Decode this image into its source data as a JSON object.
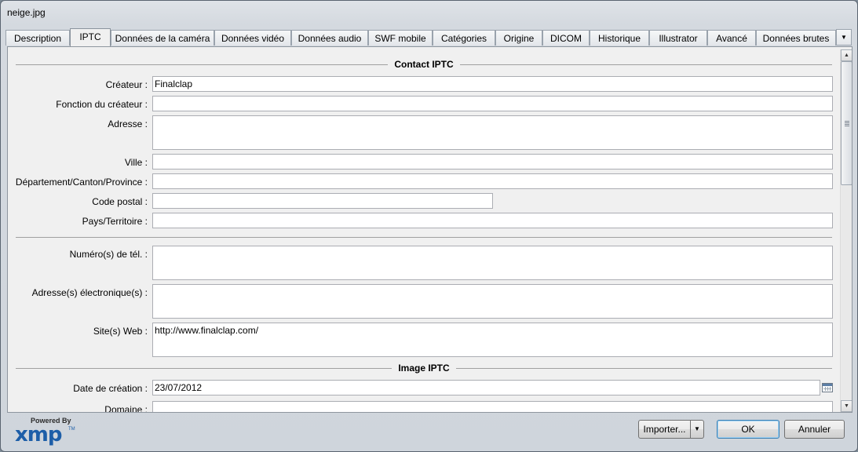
{
  "window": {
    "title": "neige.jpg"
  },
  "tabs": [
    {
      "label": "Description"
    },
    {
      "label": "IPTC",
      "active": true
    },
    {
      "label": "Données de la caméra"
    },
    {
      "label": "Données vidéo"
    },
    {
      "label": "Données audio"
    },
    {
      "label": "SWF mobile"
    },
    {
      "label": "Catégories"
    },
    {
      "label": "Origine"
    },
    {
      "label": "DICOM"
    },
    {
      "label": "Historique"
    },
    {
      "label": "Illustrator"
    },
    {
      "label": "Avancé"
    },
    {
      "label": "Données brutes"
    }
  ],
  "sections": {
    "contact": "Contact IPTC",
    "image": "Image IPTC"
  },
  "fields": {
    "createur": {
      "label": "Créateur :",
      "value": "Finalclap"
    },
    "fonction": {
      "label": "Fonction du créateur :",
      "value": ""
    },
    "adresse": {
      "label": "Adresse :",
      "value": ""
    },
    "ville": {
      "label": "Ville :",
      "value": ""
    },
    "departement": {
      "label": "Département/Canton/Province :",
      "value": ""
    },
    "code_postal": {
      "label": "Code postal :",
      "value": ""
    },
    "pays": {
      "label": "Pays/Territoire :",
      "value": ""
    },
    "telephone": {
      "label": "Numéro(s) de tél. :",
      "value": ""
    },
    "email": {
      "label": "Adresse(s) électronique(s) :",
      "value": ""
    },
    "site_web": {
      "label": "Site(s) Web :",
      "value": "http://www.finalclap.com/"
    },
    "date_creation": {
      "label": "Date de création :",
      "value": "23/07/2012"
    },
    "domaine": {
      "label": "Domaine :",
      "value": ""
    }
  },
  "footer": {
    "powered_by": "Powered By",
    "logo": "xmp",
    "tm": "TM",
    "import_label": "Importer...",
    "ok_label": "OK",
    "cancel_label": "Annuler"
  },
  "icons": {
    "tab_scroll": "chevron-down-icon",
    "date_picker": "calendar-icon",
    "scroll_up": "arrow-up-icon",
    "scroll_down": "arrow-down-icon"
  }
}
